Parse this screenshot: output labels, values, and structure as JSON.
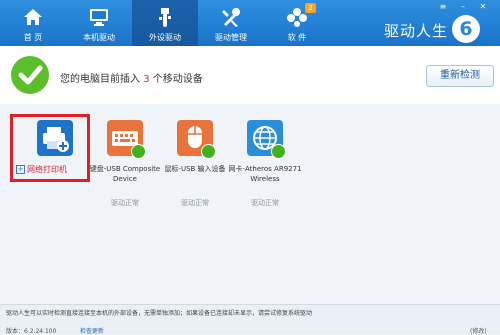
{
  "nav": {
    "tabs": [
      {
        "label": "首 页",
        "icon": "home-icon"
      },
      {
        "label": "本机驱动",
        "icon": "monitor-icon"
      },
      {
        "label": "外设驱动",
        "icon": "usb-icon"
      },
      {
        "label": "驱动管理",
        "icon": "tools-icon"
      },
      {
        "label": "软 件",
        "icon": "apps-icon",
        "badge": "2"
      }
    ],
    "active_index": 2,
    "brand": "驱动人生",
    "logo_text": "6"
  },
  "status": {
    "prefix": "您的电脑目前插入",
    "count": "3",
    "suffix": "个移动设备",
    "rescan_label": "重新检测"
  },
  "devices": [
    {
      "name": "网络打印机",
      "state": "",
      "icon": "printer-icon",
      "color": "#1f73c9"
    },
    {
      "name": "键盘-USB Composite Device",
      "state": "驱动正常",
      "icon": "keyboard-icon",
      "color": "#e8743b"
    },
    {
      "name": "鼠标-USB 输入设备",
      "state": "驱动正常",
      "icon": "mouse-icon",
      "color": "#e8743b"
    },
    {
      "name": "网卡-Atheros AR9271 Wireless",
      "state": "驱动正常",
      "icon": "globe-icon",
      "color": "#2a8ed8"
    }
  ],
  "footer": {
    "text": "驱动人生可以实时检测直接连接至本机的外部设备，无需单独添加；如果设备已连接却未显示，请尝试修复系统驱动",
    "version": "版本：6.2.24.100",
    "check_update": "检查更新",
    "right": "(修改)"
  },
  "colors": {
    "accent": "#1a73c9",
    "highlight": "#e01f26",
    "ok": "#3fb21d"
  }
}
